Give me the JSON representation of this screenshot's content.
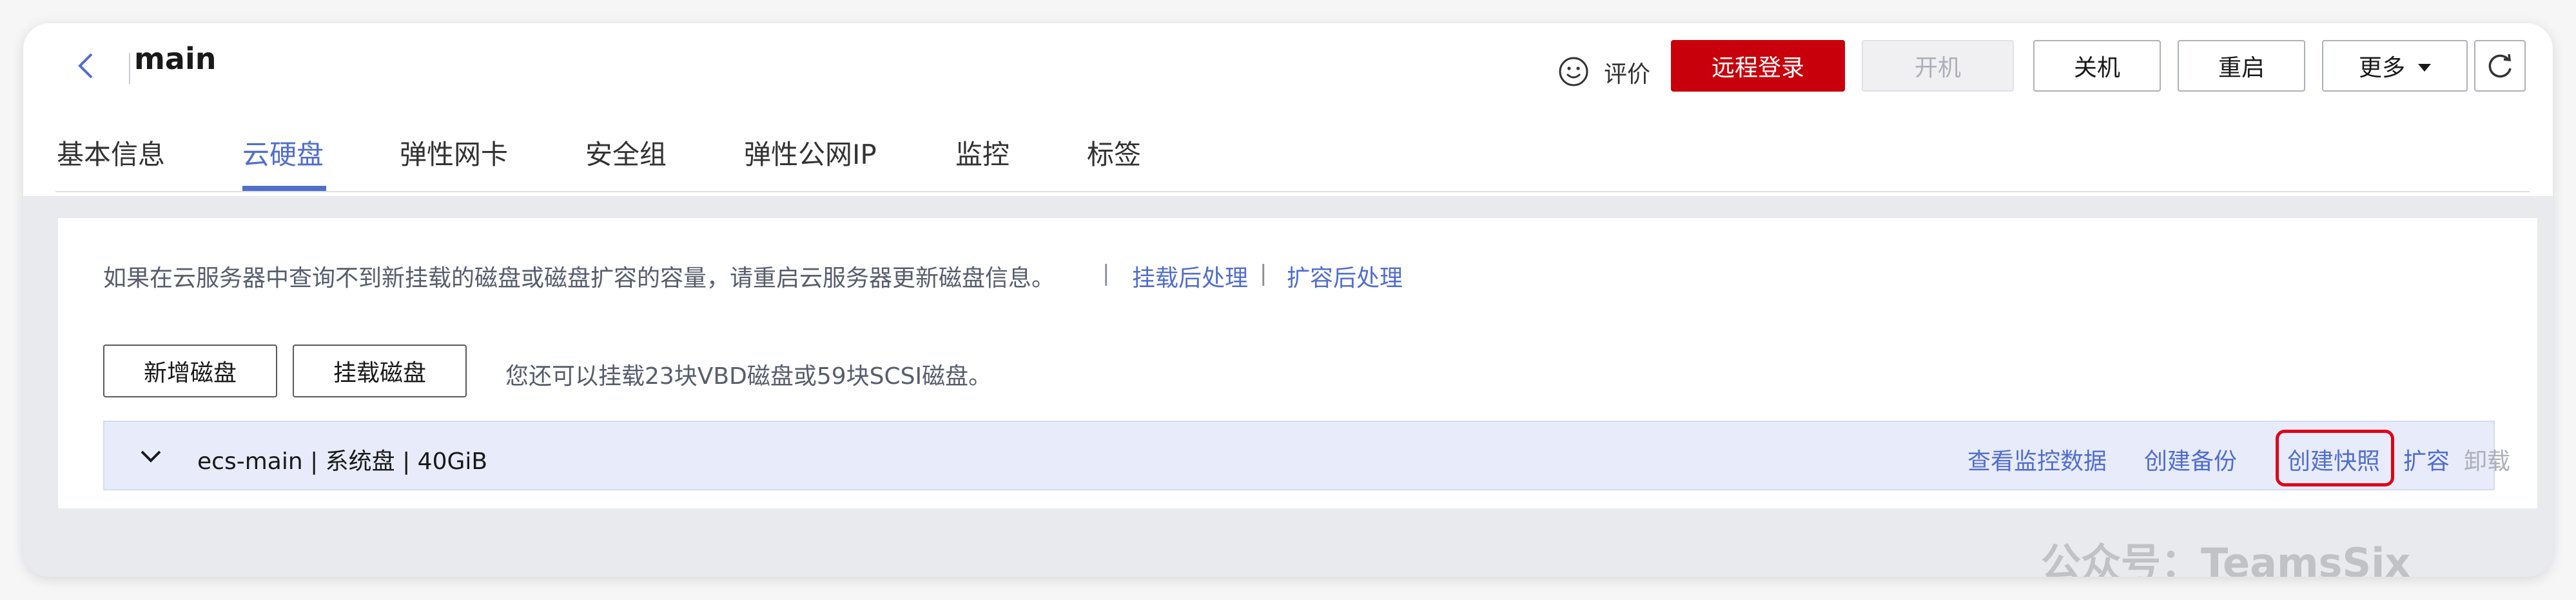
{
  "header": {
    "title": "main",
    "rate_label": "评价",
    "buttons": {
      "remote_login": "远程登录",
      "power_on": "开机",
      "power_off": "关机",
      "restart": "重启",
      "more": "更多"
    }
  },
  "tabs": [
    {
      "label": "基本信息",
      "active": false
    },
    {
      "label": "云硬盘",
      "active": true
    },
    {
      "label": "弹性网卡",
      "active": false
    },
    {
      "label": "安全组",
      "active": false
    },
    {
      "label": "弹性公网IP",
      "active": false
    },
    {
      "label": "监控",
      "active": false
    },
    {
      "label": "标签",
      "active": false
    }
  ],
  "notice": {
    "text": "如果在云服务器中查询不到新挂载的磁盘或磁盘扩容的容量，请重启云服务器更新磁盘信息。",
    "separator": "|",
    "link1": "挂载后处理",
    "link2": "扩容后处理"
  },
  "actions": {
    "add_disk": "新增磁盘",
    "attach_disk": "挂载磁盘",
    "hint": "您还可以挂载23块VBD磁盘或59块SCSI磁盘。"
  },
  "disk": {
    "name": "ecs-main | 系统盘 | 40GiB",
    "links": {
      "monitor": "查看监控数据",
      "backup": "创建备份",
      "snapshot": "创建快照",
      "expand": "扩容",
      "detach": "卸载"
    }
  },
  "watermark": "公众号：TeamsSix",
  "colors": {
    "primary_red": "#c7000b",
    "link_blue": "#526ecc",
    "highlight_red": "#e0001a"
  }
}
